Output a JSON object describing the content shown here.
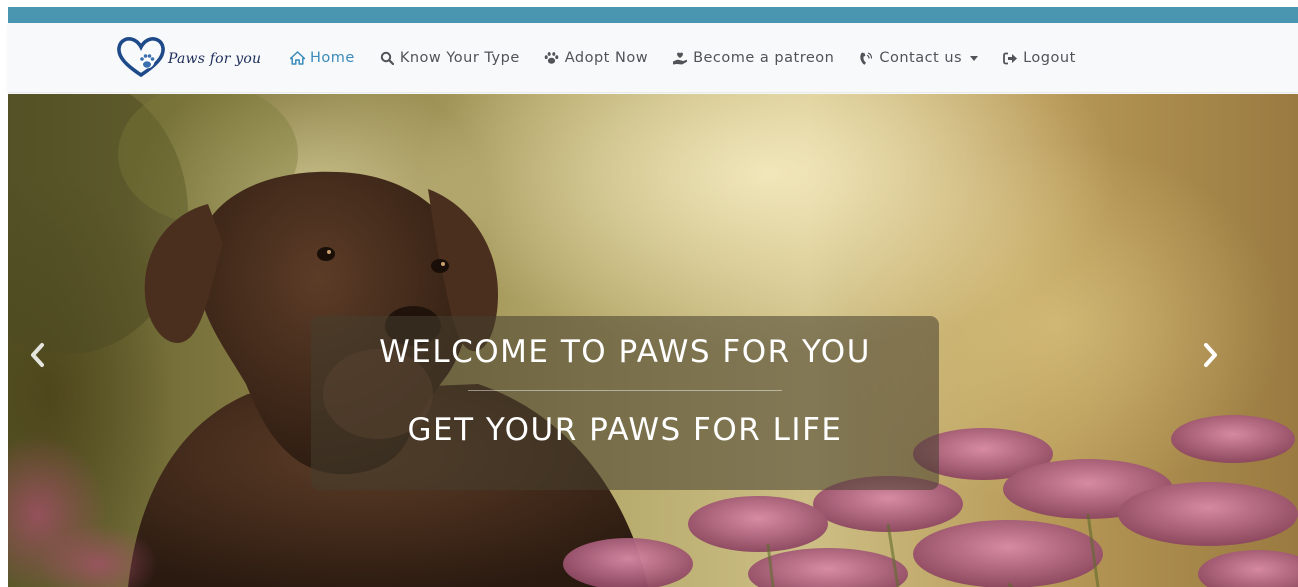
{
  "header": {
    "brand": {
      "logo_icon": "heart-paw-logo",
      "name": "Paws for you"
    },
    "nav": [
      {
        "label": "Home",
        "icon": "home-icon",
        "active": true
      },
      {
        "label": "Know Your Type",
        "icon": "search-icon",
        "active": false
      },
      {
        "label": "Adopt Now",
        "icon": "paw-icon",
        "active": false
      },
      {
        "label": "Become a patreon",
        "icon": "hand-holding-heart-icon",
        "active": false
      },
      {
        "label": "Contact us",
        "icon": "phone-volume-icon",
        "active": false,
        "dropdown": true
      },
      {
        "label": "Logout",
        "icon": "sign-out-icon",
        "active": false
      }
    ]
  },
  "carousel": {
    "title": "WELCOME TO PAWS FOR YOU",
    "subtitle": "GET YOUR PAWS FOR LIFE",
    "prev_icon": "chevron-left-icon",
    "next_icon": "chevron-right-icon"
  },
  "colors": {
    "accent_bar": "#4a96b0",
    "nav_active": "#3a8bbb",
    "nav_text": "#505458",
    "navbar_bg": "#f8f9fa",
    "logo_blue": "#1e4a8a"
  }
}
